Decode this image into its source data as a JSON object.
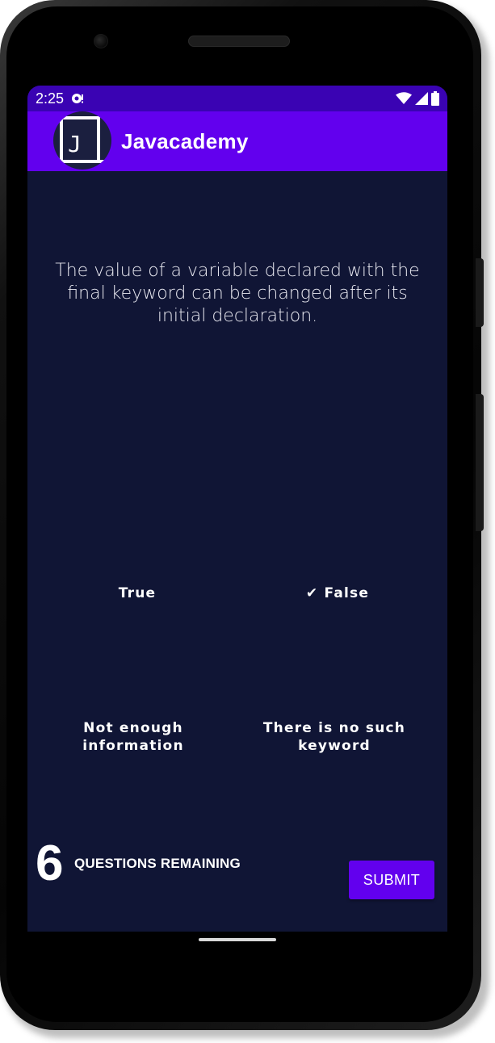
{
  "status_bar": {
    "time": "2:25",
    "notification_icon": "cast-notification-icon",
    "icons": [
      "wifi-icon",
      "cell-signal-icon",
      "battery-icon"
    ],
    "background": "#3a03b3"
  },
  "app_bar": {
    "title": "Javacademy",
    "logo_text": "J",
    "background": "#6200ee"
  },
  "quiz": {
    "question": "The value of a variable declared with the final keyword can be changed after its initial declaration.",
    "answers": [
      {
        "label": "True",
        "selected": false
      },
      {
        "label": "False",
        "selected": true,
        "check": "✔"
      },
      {
        "label": "Not enough information",
        "selected": false
      },
      {
        "label": "There is no such keyword",
        "selected": false
      }
    ],
    "remaining_count": "6",
    "remaining_label": "QUESTIONS REMAINING",
    "submit_label": "SUBMIT"
  },
  "colors": {
    "screen_background": "#101535",
    "accent": "#6200ee",
    "text": "#ffffff"
  }
}
